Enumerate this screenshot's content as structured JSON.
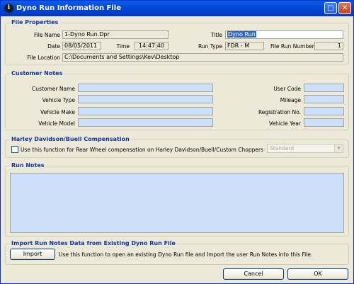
{
  "window": {
    "title": "Dyno Run Information File",
    "app_icon_glyph": "i",
    "maximize_glyph": "□",
    "close_glyph": "✕"
  },
  "file_properties": {
    "title": "File Properties",
    "file_name_label": "File Name",
    "file_name_value": "1-Dyno Run.Dpr",
    "title_label": "Title",
    "title_value": "Dyno Run",
    "date_label": "Date",
    "date_value": "08/05/2011",
    "time_label": "Time",
    "time_value": "14:47:40",
    "run_type_label": "Run Type",
    "run_type_value": "FDR - M",
    "file_run_number_label": "File Run Number",
    "file_run_number_value": "1",
    "file_location_label": "File Location",
    "file_location_value": "C:\\Documents and Settings\\Kev\\Desktop"
  },
  "customer_notes": {
    "title": "Customer Notes",
    "customer_name_label": "Customer Name",
    "vehicle_type_label": "Vehicle Type",
    "vehicle_make_label": "Vehicle Make",
    "vehicle_model_label": "Vehicle Model",
    "user_code_label": "User Code",
    "mileage_label": "Mileage",
    "registration_label": "Registration No.",
    "vehicle_year_label": "Vehicle Year"
  },
  "harley": {
    "title": "Harley Davidson/Buell Compensation",
    "checkbox_label": "Use this function for Rear Wheel compensation on Harley Davidson/Buell/Custom Choppers",
    "dropdown_value": "Standard",
    "dropdown_arrow": "▼"
  },
  "run_notes": {
    "title": "Run Notes"
  },
  "import_section": {
    "title": "Import Run Notes Data from Existing Dyno Run File",
    "import_button": "Import",
    "description": "Use this function to open an existing Dyno Run file and Import the user Run Notes into this File."
  },
  "footer": {
    "cancel_button": "Cancel",
    "ok_button": "OK"
  },
  "colors": {
    "title_bar": "#0448d8",
    "group_title": "#1034a6",
    "editable_field": "#cce0fb",
    "window_bg": "#ece9d8"
  }
}
